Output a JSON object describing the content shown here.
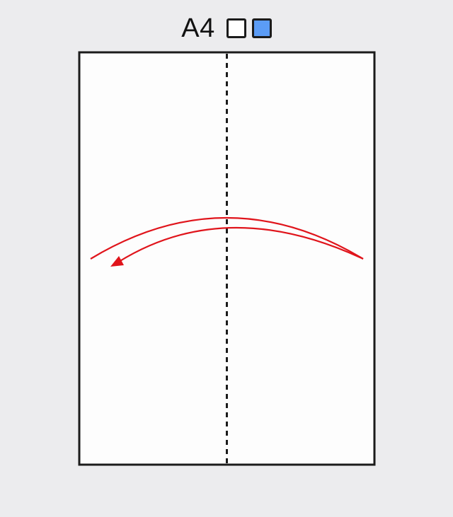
{
  "header": {
    "paper_size": "A4"
  },
  "colors": {
    "paper_front": "#ffffff",
    "paper_back": "#5b9cf6",
    "fold_arrow": "#e0141b",
    "outline": "#1b1b1b",
    "background": "#ececee"
  },
  "diagram": {
    "fold_line_style": "valley-fold-dashed",
    "arrow_icon": "fold-arrow-right-to-left"
  }
}
